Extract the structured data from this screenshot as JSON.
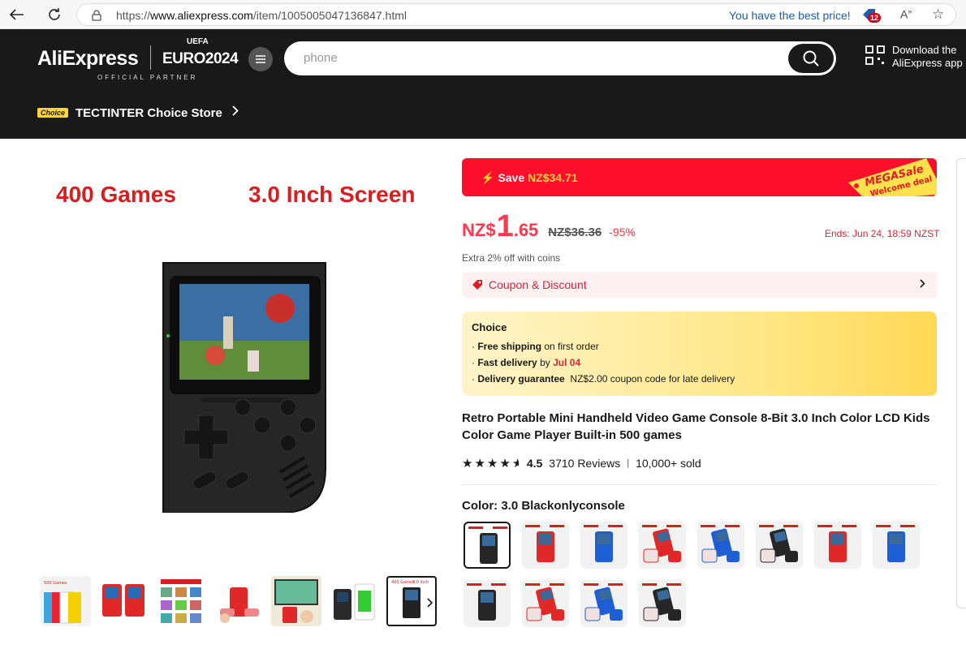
{
  "browser": {
    "url_scheme": "https://",
    "url_domain": "www.aliexpress.com",
    "url_path": "/item/1005005047136847.html",
    "best_price": "You have the best price!",
    "extension_count": "12"
  },
  "header": {
    "logo": "AliExpress",
    "uefa": "UEFA",
    "euro": "EURO2024",
    "partner": "OFFICIAL PARTNER",
    "search_placeholder": "phone",
    "download_line1": "Download the",
    "download_line2": "AliExpress app",
    "choice_tag": "Choice",
    "store_name": "TECTINTER Choice Store"
  },
  "gallery": {
    "promo_left": "400 Games",
    "promo_right": "3.0 Inch Screen",
    "thumb_count": 7,
    "selected_thumb": 6
  },
  "product": {
    "save_label": "Save",
    "save_amount": "NZ$34.71",
    "mega_line1": "MEGASale",
    "mega_line2": "Welcome deal",
    "price_currency": "NZ$",
    "price_int": "1",
    "price_dec": ".65",
    "original_price": "NZ$36.36",
    "discount": "-95%",
    "ends": "Ends: Jun 24, 18:59 NZST",
    "coins": "Extra 2% off with coins",
    "coupon_label": "Coupon & Discount",
    "choice_title": "Choice",
    "free_shipping": "Free shipping",
    "free_shipping_rest": "on first order",
    "fast_delivery": "Fast delivery",
    "fast_delivery_by": "by",
    "fast_delivery_date": "Jul 04",
    "guarantee": "Delivery guarantee",
    "guarantee_rest": "NZ$2.00 coupon code for late delivery",
    "title": "Retro Portable Mini Handheld Video Game Console 8-Bit 3.0 Inch Color LCD Kids Color Game Player Built-in 500 games",
    "rating": "4.5",
    "stars": 4.5,
    "reviews": "3710 Reviews",
    "sold": "10,000+ sold",
    "color_label": "Color: 3.0 Blackonlyconsole"
  },
  "colors": {
    "brand_red": "#fd384f",
    "header_bg": "#191919",
    "save_bar": "#fd0f2c"
  },
  "swatches": [
    {
      "color": "black",
      "kind": "console"
    },
    {
      "color": "red",
      "kind": "console"
    },
    {
      "color": "blue",
      "kind": "console"
    },
    {
      "color": "red",
      "kind": "console+pad"
    },
    {
      "color": "blue",
      "kind": "console+pad"
    },
    {
      "color": "black",
      "kind": "console+pad"
    },
    {
      "color": "red",
      "kind": "console"
    },
    {
      "color": "blue",
      "kind": "console"
    },
    {
      "color": "black",
      "kind": "console"
    },
    {
      "color": "red",
      "kind": "console+pad"
    },
    {
      "color": "blue",
      "kind": "console+pad"
    },
    {
      "color": "black",
      "kind": "console+pad"
    }
  ]
}
